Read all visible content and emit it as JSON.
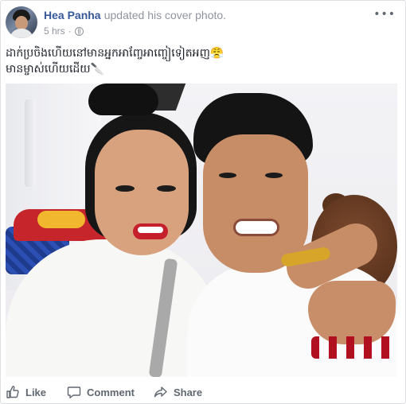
{
  "post": {
    "author_name": "Hea Panha",
    "action_text": "updated his cover photo.",
    "timestamp": "5 hrs",
    "separator": "·",
    "more_glyph": "•••",
    "caption_lines": [
      "ដាក់ប្រចិងហើយនៅមានអ្នកអាញ្ចែអាញ្ចៀទៀតអញ😤",
      "មានម្ចាស់ហើយដើយ🔪"
    ]
  },
  "actions": {
    "like_label": "Like",
    "comment_label": "Comment",
    "share_label": "Share"
  },
  "icons": {
    "privacy": "globe-icon",
    "more": "more-icon",
    "like": "like-icon",
    "comment": "comment-icon",
    "share": "share-icon"
  },
  "colors": {
    "author": "#365899",
    "meta": "#90949c",
    "action_text": "#606770"
  }
}
